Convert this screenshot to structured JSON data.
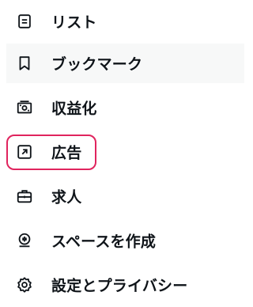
{
  "menu": {
    "items": [
      {
        "label": "リスト",
        "icon": "list-icon"
      },
      {
        "label": "ブックマーク",
        "icon": "bookmark-icon"
      },
      {
        "label": "収益化",
        "icon": "monetization-icon"
      },
      {
        "label": "広告",
        "icon": "ads-external-link-icon"
      },
      {
        "label": "求人",
        "icon": "briefcase-icon"
      },
      {
        "label": "スペースを作成",
        "icon": "microphone-icon"
      },
      {
        "label": "設定とプライバシー",
        "icon": "gear-icon"
      }
    ]
  },
  "colors": {
    "text": "#0f1419",
    "hover_background": "#f7f8f8",
    "highlight_ring": "#e0245e"
  }
}
